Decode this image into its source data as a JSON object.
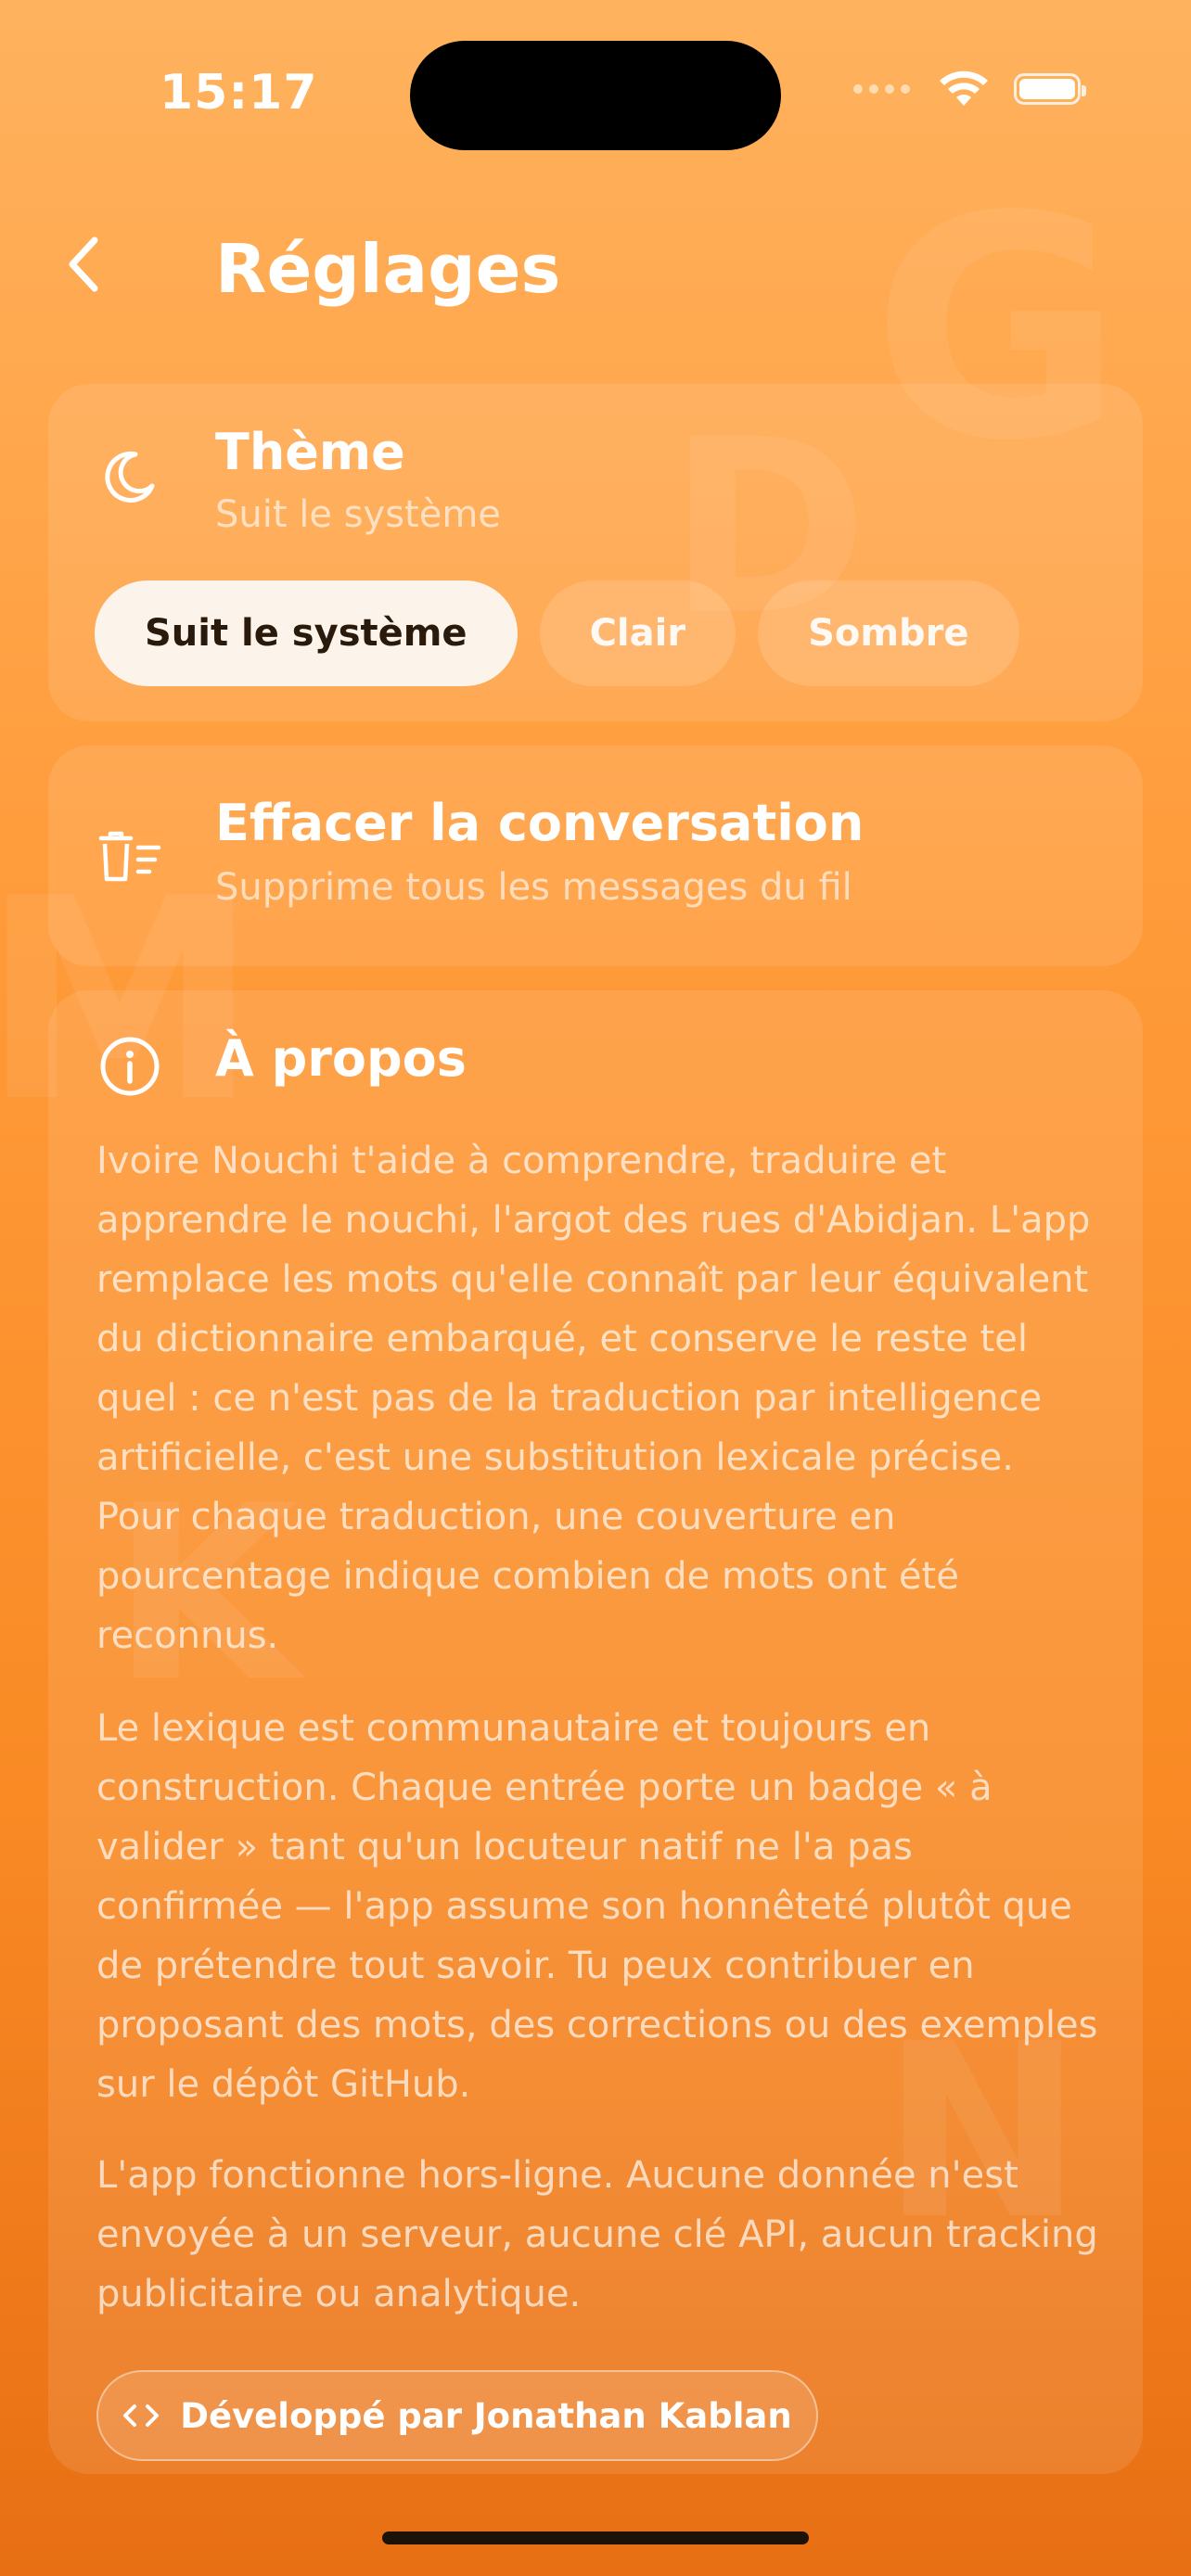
{
  "status_bar": {
    "time": "15:17",
    "battery_level": 1.0
  },
  "header": {
    "title": "Réglages"
  },
  "theme": {
    "title": "Thème",
    "subtitle": "Suit le système",
    "options": [
      "Suit le système",
      "Clair",
      "Sombre"
    ],
    "selected_option": "Suit le système"
  },
  "clear": {
    "title": "Effacer la conversation",
    "subtitle": "Supprime tous les messages du fil"
  },
  "about": {
    "title": "À propos",
    "paragraphs": [
      "Ivoire Nouchi t'aide à comprendre, traduire et apprendre le nouchi, l'argot des rues d'Abidjan. L'app remplace les mots qu'elle connaît par leur équivalent du dictionnaire embarqué, et conserve le reste tel quel : ce n'est pas de la traduction par intelligence artificielle, c'est une substitution lexicale précise. Pour chaque traduction, une couverture en pourcentage indique combien de mots ont été reconnus.",
      "Le lexique est communautaire et toujours en construction. Chaque entrée porte un badge « à valider » tant qu'un locuteur natif ne l'a pas confirmée — l'app assume son honnêteté plutôt que de prétendre tout savoir. Tu peux contribuer en proposant des mots, des corrections ou des exemples sur le dépôt GitHub.",
      "L'app fonctionne hors-ligne. Aucune donnée n'est envoyée à un serveur, aucune clé API, aucun tracking publicitaire ou analytique."
    ],
    "developer_button": "Développé par Jonathan Kablan"
  },
  "colors": {
    "gradient_top": "#FFB25E",
    "gradient_bottom": "#E86F14",
    "selected_chip_bg": "#FCF4EA",
    "selected_chip_text": "#2A1A0C"
  }
}
